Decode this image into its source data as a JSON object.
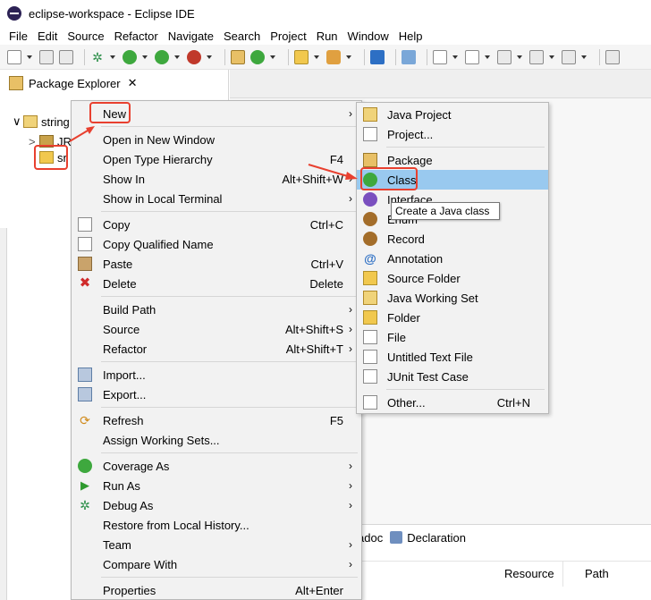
{
  "window": {
    "title": "eclipse-workspace - Eclipse IDE"
  },
  "menubar": [
    "File",
    "Edit",
    "Source",
    "Refactor",
    "Navigate",
    "Search",
    "Project",
    "Run",
    "Window",
    "Help"
  ],
  "package_explorer": {
    "tab_label": "Package Explorer",
    "close_glyph": "✕",
    "tree": [
      {
        "toggle": "∨",
        "label": "string"
      },
      {
        "toggle": ">",
        "label": "JR"
      },
      {
        "toggle": "",
        "label": "sr"
      }
    ]
  },
  "context_menu": {
    "items": [
      {
        "label": "New",
        "shortcut": "",
        "submenu": true
      },
      {
        "label": "Open in New Window",
        "shortcut": ""
      },
      {
        "label": "Open Type Hierarchy",
        "shortcut": "F4"
      },
      {
        "label": "Show In",
        "shortcut": "Alt+Shift+W",
        "submenu": true
      },
      {
        "label": "Show in Local Terminal",
        "shortcut": "",
        "submenu": true
      },
      {
        "label": "Copy",
        "shortcut": "Ctrl+C"
      },
      {
        "label": "Copy Qualified Name",
        "shortcut": ""
      },
      {
        "label": "Paste",
        "shortcut": "Ctrl+V"
      },
      {
        "label": "Delete",
        "shortcut": "Delete"
      },
      {
        "label": "Build Path",
        "shortcut": "",
        "submenu": true
      },
      {
        "label": "Source",
        "shortcut": "Alt+Shift+S",
        "submenu": true
      },
      {
        "label": "Refactor",
        "shortcut": "Alt+Shift+T",
        "submenu": true
      },
      {
        "label": "Import...",
        "shortcut": ""
      },
      {
        "label": "Export...",
        "shortcut": ""
      },
      {
        "label": "Refresh",
        "shortcut": "F5"
      },
      {
        "label": "Assign Working Sets...",
        "shortcut": ""
      },
      {
        "label": "Coverage As",
        "shortcut": "",
        "submenu": true
      },
      {
        "label": "Run As",
        "shortcut": "",
        "submenu": true
      },
      {
        "label": "Debug As",
        "shortcut": "",
        "submenu": true
      },
      {
        "label": "Restore from Local History...",
        "shortcut": ""
      },
      {
        "label": "Team",
        "shortcut": "",
        "submenu": true
      },
      {
        "label": "Compare With",
        "shortcut": "",
        "submenu": true
      },
      {
        "label": "Properties",
        "shortcut": "Alt+Enter"
      }
    ],
    "arrow_glyph": "›"
  },
  "new_submenu": {
    "items": [
      {
        "label": "Java Project",
        "shortcut": ""
      },
      {
        "label": "Project...",
        "shortcut": ""
      },
      {
        "label": "Package",
        "shortcut": ""
      },
      {
        "label": "Class",
        "shortcut": ""
      },
      {
        "label": "Interface",
        "shortcut": ""
      },
      {
        "label": "Enum",
        "shortcut": ""
      },
      {
        "label": "Record",
        "shortcut": ""
      },
      {
        "label": "Annotation",
        "shortcut": ""
      },
      {
        "label": "Source Folder",
        "shortcut": ""
      },
      {
        "label": "Java Working Set",
        "shortcut": ""
      },
      {
        "label": "Folder",
        "shortcut": ""
      },
      {
        "label": "File",
        "shortcut": ""
      },
      {
        "label": "Untitled Text File",
        "shortcut": ""
      },
      {
        "label": "JUnit Test Case",
        "shortcut": ""
      },
      {
        "label": "Other...",
        "shortcut": "Ctrl+N"
      }
    ],
    "selected": "Class"
  },
  "tooltip": {
    "text": "Create a Java class"
  },
  "bottom_panel": {
    "tab_partial": "adoc",
    "tab_declaration": "Declaration",
    "columns": [
      "Resource",
      "Path"
    ]
  },
  "colors": {
    "selection": "#99c9ef",
    "annotation_red": "#e8402f",
    "menu_bg": "#f2f2f2"
  }
}
